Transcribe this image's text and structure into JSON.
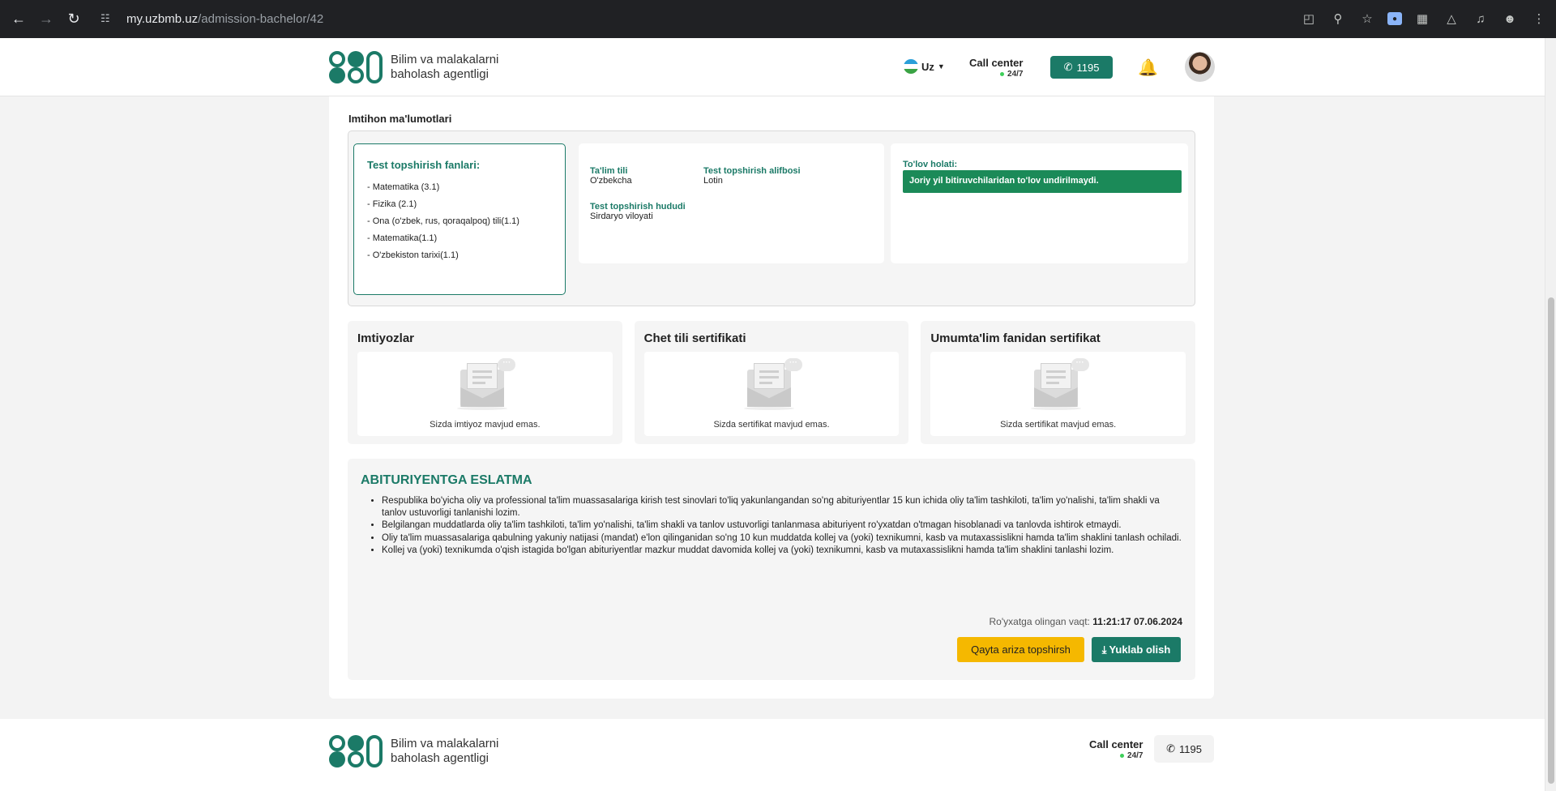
{
  "browser": {
    "url_host": "my.uzbmb.uz",
    "url_path": "/admission-bachelor/42",
    "back_icon": "arrow-left-icon",
    "forward_icon": "arrow-right-icon",
    "reload_icon": "reload-icon"
  },
  "header": {
    "logo_line1": "Bilim va malakalarni",
    "logo_line2": "baholash agentligi",
    "lang": "Uz",
    "call_center": "Call center",
    "call_center_hours": "24/7",
    "phone": "1195"
  },
  "exam": {
    "section_title": "Imtihon ma'lumotlari",
    "subjects_title": "Test topshirish fanlari:",
    "subjects": [
      "- Matematika (3.1)",
      "- Fizika (2.1)",
      "- Ona (o'zbek, rus, qoraqalpoq) tili(1.1)",
      "- Matematika(1.1)",
      "- O'zbekiston tarixi(1.1)"
    ],
    "lang_label": "Ta'lim tili",
    "lang_value": "O'zbekcha",
    "alphabet_label": "Test topshirish alifbosi",
    "alphabet_value": "Lotin",
    "region_label": "Test topshirish hududi",
    "region_value": "Sirdaryo viloyati",
    "payment_label": "To'lov holati:",
    "payment_status": "Joriy yil bitiruvchilaridan to'lov undirilmaydi."
  },
  "cards": [
    {
      "title": "Imtiyozlar",
      "message": "Sizda imtiyoz mavjud emas."
    },
    {
      "title": "Chet tili sertifikati",
      "message": "Sizda sertifikat mavjud emas."
    },
    {
      "title": "Umumta'lim fanidan sertifikat",
      "message": "Sizda sertifikat mavjud emas."
    }
  ],
  "notice": {
    "title": "ABITURIYENTGA ESLATMA",
    "items": [
      "Respublika bo'yicha oliy va professional ta'lim muassasalariga kirish test sinovlari to'liq yakunlangandan so'ng abituriyentlar 15 kun ichida oliy ta'lim tashkiloti, ta'lim yo'nalishi, ta'lim shakli va tanlov ustuvorligi tanlanishi lozim.",
      "Belgilangan muddatlarda oliy ta'lim tashkiloti, ta'lim yo'nalishi, ta'lim shakli va tanlov ustuvorligi tanlanmasa abituriyent ro'yxatdan o'tmagan hisoblanadi va tanlovda ishtirok etmaydi.",
      "Oliy ta'lim muassasalariga qabulning yakuniy natijasi (mandat) e'lon qilinganidan so'ng 10 kun muddatda kollej va (yoki) texnikumni, kasb va mutaxassislikni hamda ta'lim shaklini tanlash ochiladi.",
      "Kollej va (yoki) texnikumda o'qish istagida bo'lgan abituriyentlar mazkur muddat davomida kollej va (yoki) texnikumni, kasb va mutaxassislikni hamda ta'lim shaklini tanlashi lozim."
    ],
    "reg_label": "Ro'yxatga olingan vaqt:",
    "reg_value": "11:21:17 07.06.2024",
    "retry_button": "Qayta ariza topshirsh",
    "download_button": "Yuklab olish"
  },
  "footer": {
    "logo_line1": "Bilim va malakalarni",
    "logo_line2": "baholash agentligi",
    "call_center": "Call center",
    "call_center_hours": "24/7",
    "phone": "1195"
  },
  "colors": {
    "brand": "#1b7a67",
    "payment": "#1b8a58",
    "retry": "#f5b800"
  }
}
